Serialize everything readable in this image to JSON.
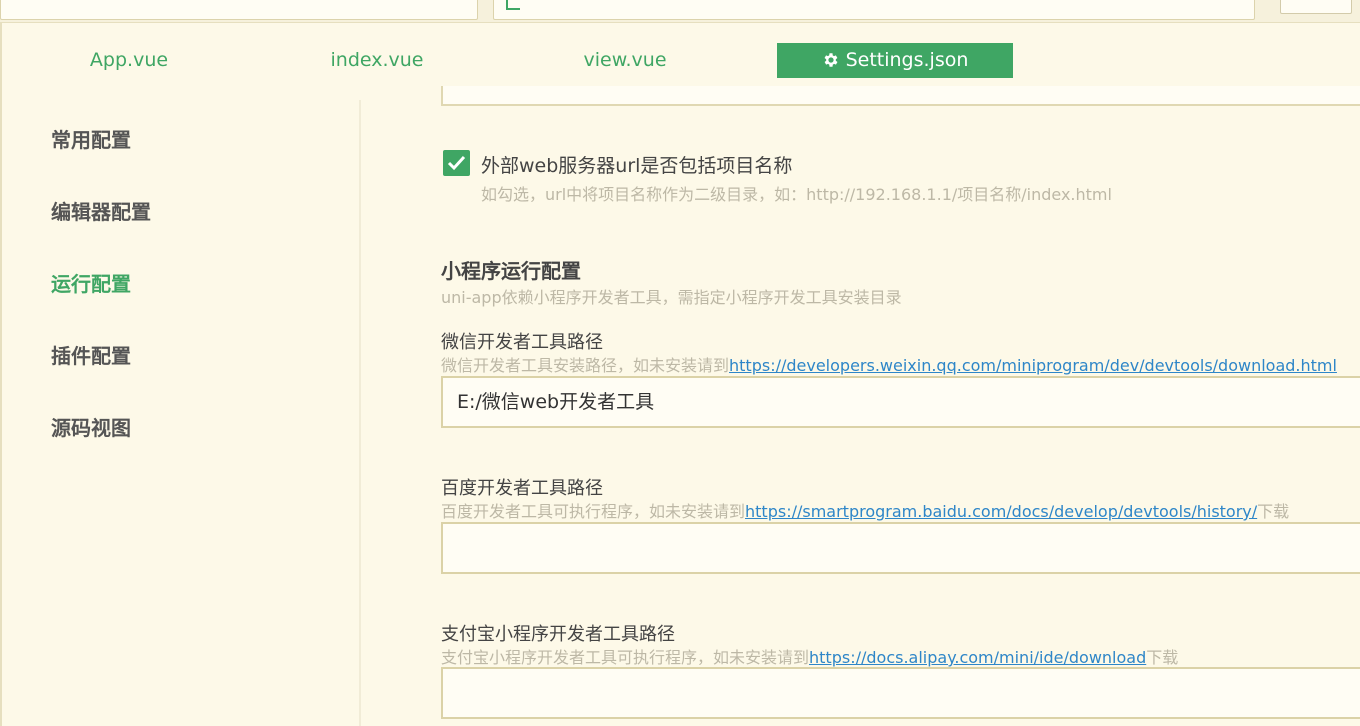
{
  "tabs": [
    {
      "label": "App.vue"
    },
    {
      "label": "index.vue"
    },
    {
      "label": "view.vue"
    },
    {
      "label": "Settings.json"
    }
  ],
  "sidebar": {
    "items": [
      {
        "label": "常用配置"
      },
      {
        "label": "编辑器配置"
      },
      {
        "label": "运行配置"
      },
      {
        "label": "插件配置"
      },
      {
        "label": "源码视图"
      }
    ]
  },
  "run_config": {
    "web_url_option": {
      "label": "外部web服务器url是否包括项目名称",
      "checked": true,
      "hint": "如勾选，url中将项目名称作为二级目录，如：http://192.168.1.1/项目名称/index.html"
    },
    "mp_section": {
      "title": "小程序运行配置",
      "subtitle": "uni-app依赖小程序开发者工具，需指定小程序开发工具安装目录"
    },
    "wechat": {
      "label": "微信开发者工具路径",
      "hint_prefix": "微信开发者工具安装路径，如未安装请到",
      "link": "https://developers.weixin.qq.com/miniprogram/dev/devtools/download.html",
      "value": "E:/微信web开发者工具"
    },
    "baidu": {
      "label": "百度开发者工具路径",
      "hint_prefix": "百度开发者工具可执行程序，如未安装请到",
      "link": "https://smartprogram.baidu.com/docs/develop/devtools/history/",
      "hint_suffix": "下载",
      "value": ""
    },
    "alipay": {
      "label": "支付宝小程序开发者工具路径",
      "hint_prefix": "支付宝小程序开发者工具可执行程序，如未安装请到",
      "link": "https://docs.alipay.com/mini/ide/download",
      "hint_suffix": "下载",
      "value": ""
    }
  },
  "colors": {
    "accent": "#3fa664",
    "background": "#fdf9e8",
    "link": "#2e86c8"
  }
}
